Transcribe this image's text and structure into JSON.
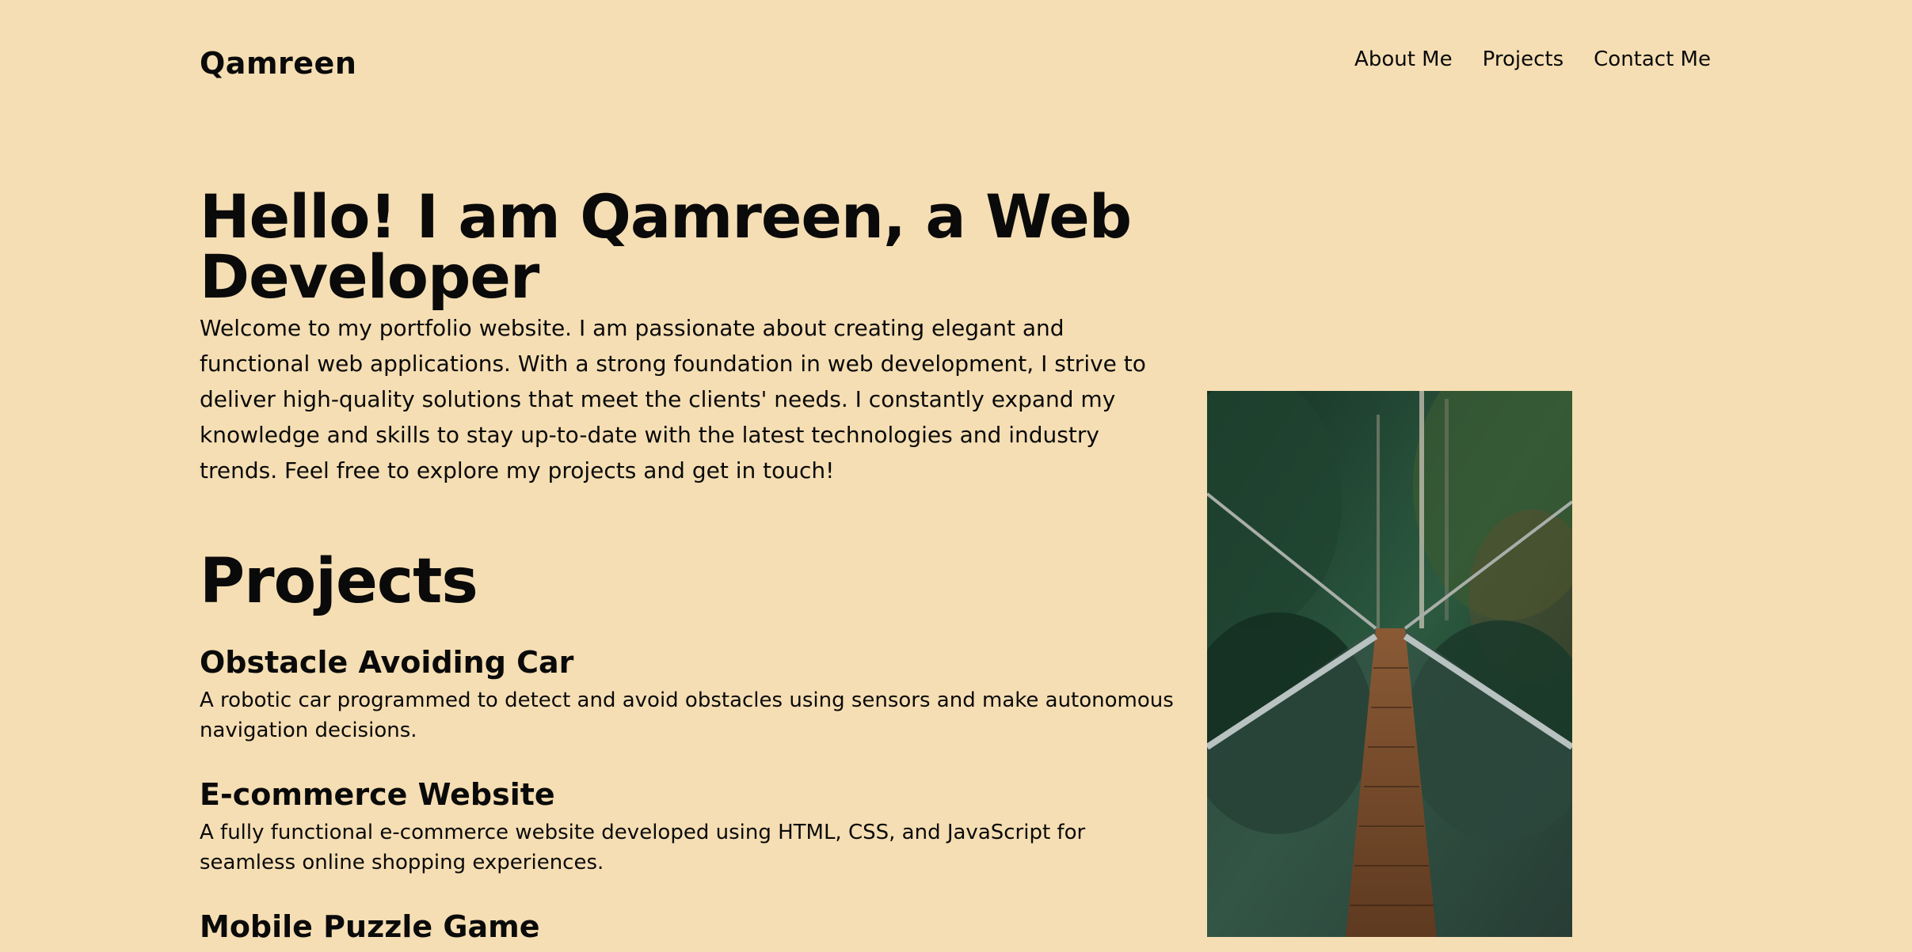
{
  "header": {
    "brand": "Qamreen",
    "nav": [
      {
        "label": "About Me"
      },
      {
        "label": "Projects"
      },
      {
        "label": "Contact Me"
      }
    ]
  },
  "hero": {
    "title": "Hello! I am Qamreen, a Web Developer",
    "intro": "Welcome to my portfolio website. I am passionate about creating elegant and functional web applications. With a strong foundation in web development, I strive to deliver high-quality solutions that meet the clients' needs. I constantly expand my knowledge and skills to stay up-to-date with the latest technologies and industry trends. Feel free to explore my projects and get in touch!"
  },
  "projects": {
    "heading": "Projects",
    "items": [
      {
        "title": "Obstacle Avoiding Car",
        "description": "A robotic car programmed to detect and avoid obstacles using sensors and make autonomous navigation decisions."
      },
      {
        "title": "E-commerce Website",
        "description": "A fully functional e-commerce website developed using HTML, CSS, and JavaScript for seamless online shopping experiences."
      },
      {
        "title": "Mobile Puzzle Game",
        "description": ""
      }
    ]
  },
  "colors": {
    "background": "#f5deb3",
    "text": "#0a0a0a"
  }
}
